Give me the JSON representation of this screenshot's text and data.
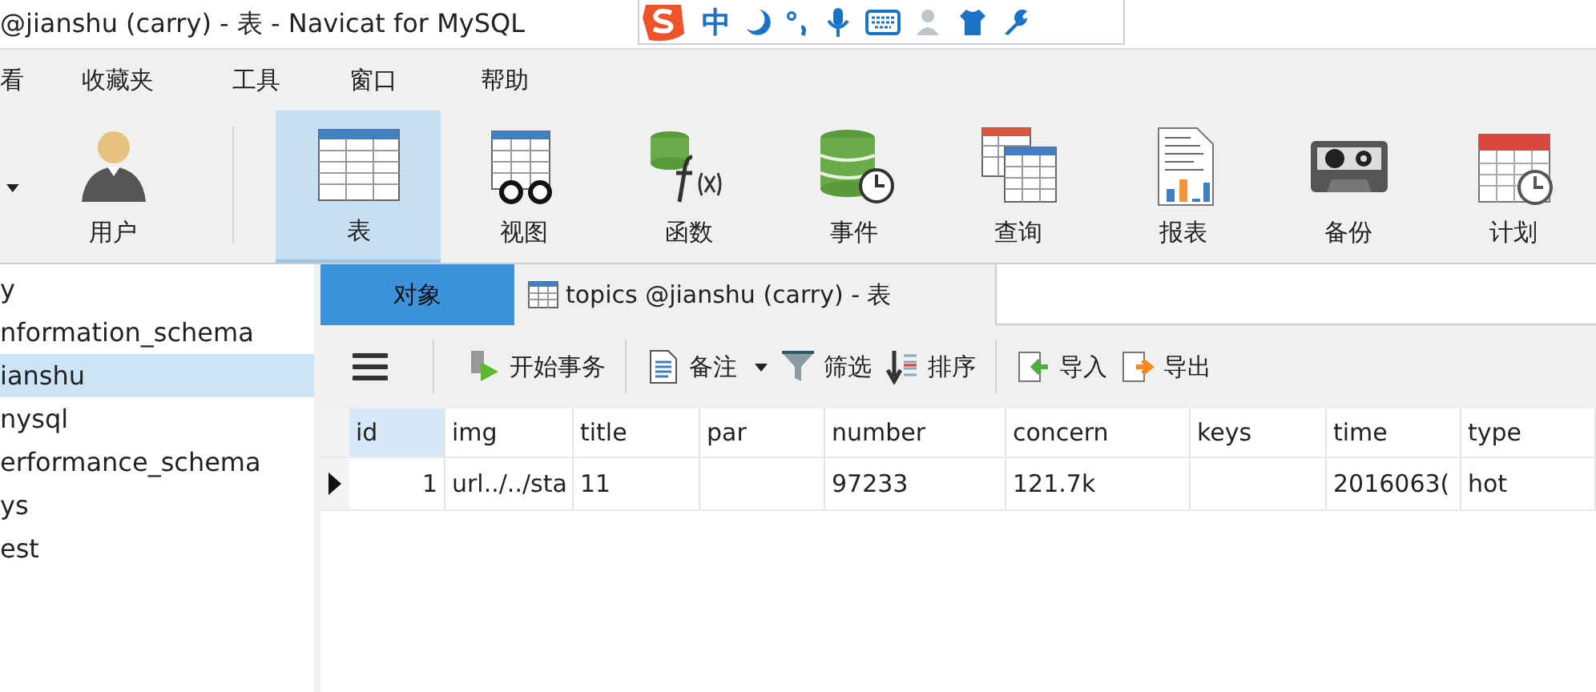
{
  "window": {
    "title": "@jianshu (carry) - 表 - Navicat for MySQL"
  },
  "ime_toolbar": {
    "mode": "中"
  },
  "menu": [
    "看",
    "收藏夹",
    "工具",
    "窗口",
    "帮助"
  ],
  "toolbar": [
    {
      "kind": "user",
      "label": "用户",
      "selected": false
    },
    {
      "kind": "table",
      "label": "表",
      "selected": true
    },
    {
      "kind": "view",
      "label": "视图",
      "selected": false
    },
    {
      "kind": "function",
      "label": "函数",
      "selected": false
    },
    {
      "kind": "event",
      "label": "事件",
      "selected": false
    },
    {
      "kind": "query",
      "label": "查询",
      "selected": false
    },
    {
      "kind": "report",
      "label": "报表",
      "selected": false
    },
    {
      "kind": "backup",
      "label": "备份",
      "selected": false
    },
    {
      "kind": "schedule",
      "label": "计划",
      "selected": false
    }
  ],
  "sidebar": {
    "items": [
      {
        "label": "y",
        "selected": false
      },
      {
        "label": "nformation_schema",
        "selected": false
      },
      {
        "label": "ianshu",
        "selected": true
      },
      {
        "label": "nysql",
        "selected": false
      },
      {
        "label": "erformance_schema",
        "selected": false
      },
      {
        "label": "ys",
        "selected": false
      },
      {
        "label": "est",
        "selected": false
      }
    ]
  },
  "tabs": [
    {
      "label": "对象",
      "selected": false,
      "kind": "objects"
    },
    {
      "label": "topics @jianshu (carry) - 表",
      "selected": true,
      "kind": "table"
    }
  ],
  "table_toolbar": [
    {
      "kind": "menu"
    },
    {
      "kind": "transaction",
      "label": "开始事务"
    },
    {
      "kind": "note",
      "label": "备注"
    },
    {
      "kind": "filter",
      "label": "筛选"
    },
    {
      "kind": "sort",
      "label": "排序"
    },
    {
      "kind": "import",
      "label": "导入"
    },
    {
      "kind": "export",
      "label": "导出"
    }
  ],
  "table": {
    "columns": [
      "id",
      "img",
      "title",
      "par",
      "number",
      "concern",
      "keys",
      "time",
      "type"
    ],
    "rows": [
      {
        "selected": true,
        "cells": [
          "1",
          "url../../sta",
          "11",
          "",
          "97233",
          "121.7k",
          "",
          "2016063(",
          "hot"
        ]
      }
    ]
  }
}
